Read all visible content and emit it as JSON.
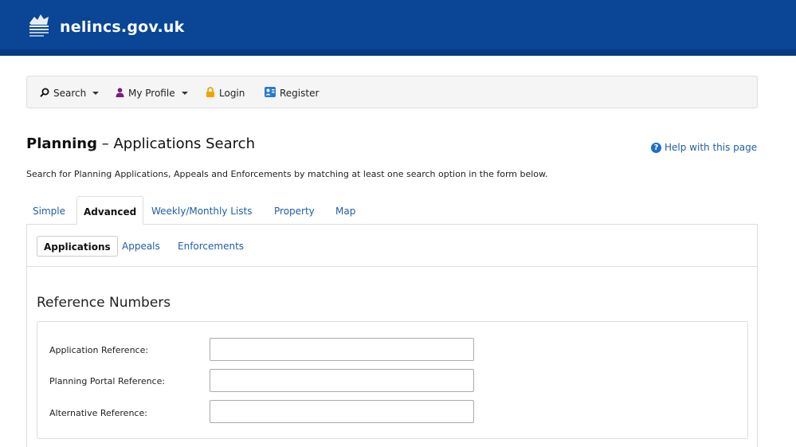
{
  "header": {
    "site_name": "nelincs.gov.uk",
    "logo_icon": "council-crest-icon",
    "bg_color": "#0a4596"
  },
  "nav": {
    "search_label": "Search",
    "profile_label": "My Profile",
    "login_label": "Login",
    "register_label": "Register"
  },
  "page": {
    "title_strong": "Planning",
    "title_rest": " – Applications Search",
    "help_label": "Help with this page",
    "intro": "Search for Planning Applications, Appeals and Enforcements by matching at least one search option in the form below."
  },
  "tabs": [
    {
      "label": "Simple"
    },
    {
      "label": "Advanced"
    },
    {
      "label": "Weekly/Monthly Lists"
    },
    {
      "label": "Property"
    },
    {
      "label": "Map"
    }
  ],
  "subtabs": [
    {
      "label": "Applications"
    },
    {
      "label": "Appeals"
    },
    {
      "label": "Enforcements"
    }
  ],
  "reference_section": {
    "title": "Reference Numbers",
    "fields": [
      {
        "label": "Application Reference:",
        "value": ""
      },
      {
        "label": "Planning Portal Reference:",
        "value": ""
      },
      {
        "label": "Alternative Reference:",
        "value": ""
      }
    ]
  }
}
